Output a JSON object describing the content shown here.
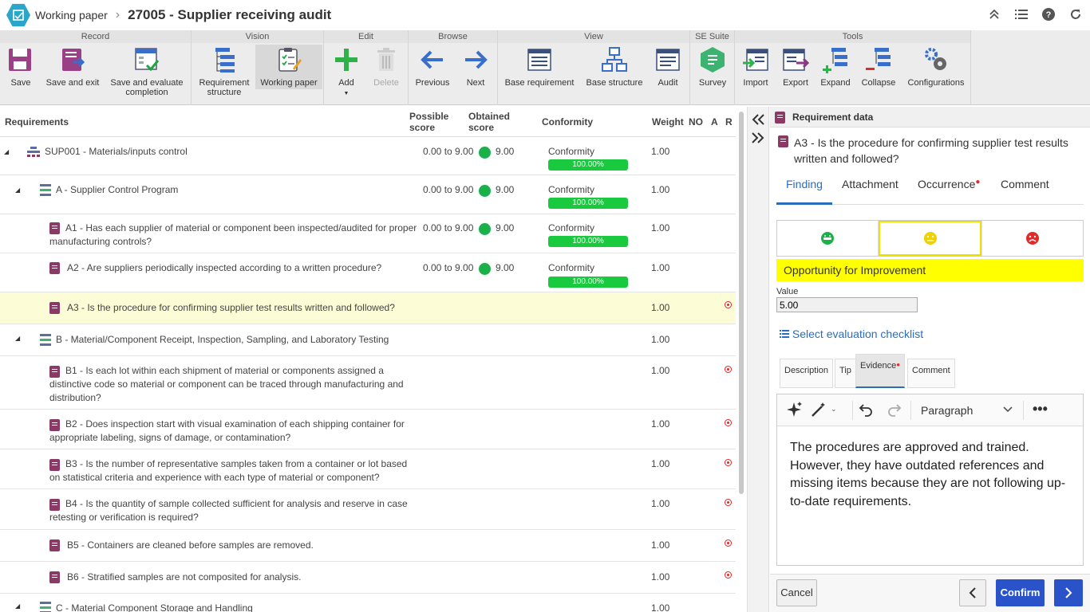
{
  "header": {
    "crumb_parent": "Working paper",
    "separator": "›",
    "title": "27005 - Supplier receiving audit",
    "icons": [
      "collapse-up-icon",
      "list-icon",
      "help-icon",
      "refresh-icon"
    ]
  },
  "ribbon": {
    "groups": {
      "record": "Record",
      "vision": "Vision",
      "edit": "Edit",
      "browse": "Browse",
      "view": "View",
      "suite": "SE Suite",
      "tools": "Tools"
    },
    "buttons": {
      "save": "Save",
      "save_exit": "Save and exit",
      "save_eval_1": "Save and evaluate",
      "save_eval_2": "completion",
      "req_struct_1": "Requirement",
      "req_struct_2": "structure",
      "working_paper": "Working paper",
      "add": "Add",
      "delete": "Delete",
      "previous": "Previous",
      "next": "Next",
      "base_requirement": "Base requirement",
      "base_structure": "Base structure",
      "audit": "Audit",
      "survey": "Survey",
      "import": "Import",
      "export": "Export",
      "expand": "Expand",
      "collapse": "Collapse",
      "configurations": "Configurations"
    }
  },
  "grid": {
    "headers": {
      "requirements": "Requirements",
      "possible_1": "Possible",
      "possible_2": "score",
      "obtained_1": "Obtained",
      "obtained_2": "score",
      "conformity": "Conformity",
      "weight": "Weight",
      "no": "NO",
      "a": "A",
      "r": "R"
    },
    "rows": [
      {
        "text": "SUP001 - Materials/inputs control",
        "possible": "0.00 to 9.00",
        "obtained": "9.00",
        "conf": "Conformity",
        "pct": "100.00%",
        "weight": "1.00"
      },
      {
        "text": "A - Supplier Control Program",
        "possible": "0.00 to 9.00",
        "obtained": "9.00",
        "conf": "Conformity",
        "pct": "100.00%",
        "weight": "1.00"
      },
      {
        "text": "A1 - Has each supplier of material or component been inspected/audited for proper manufacturing controls?",
        "possible": "0.00 to 9.00",
        "obtained": "9.00",
        "conf": "Conformity",
        "pct": "100.00%",
        "weight": "1.00"
      },
      {
        "text": "A2 - Are suppliers periodically inspected according to a written procedure?",
        "possible": "0.00 to 9.00",
        "obtained": "9.00",
        "conf": "Conformity",
        "pct": "100.00%",
        "weight": "1.00"
      },
      {
        "text": "A3 - Is the procedure for confirming supplier test results written and followed?",
        "weight": "1.00"
      },
      {
        "text": "B - Material/Component Receipt, Inspection, Sampling, and Laboratory Testing",
        "weight": "1.00"
      },
      {
        "text": "B1 - Is each lot within each shipment of material or components assigned a distinctive code so material or component can be traced through manufacturing and distribution?",
        "weight": "1.00"
      },
      {
        "text": "B2 - Does inspection start with visual examination of each shipping container for appropriate labeling, signs of damage, or contamination?",
        "weight": "1.00"
      },
      {
        "text": "B3 - Is the number of representative samples taken from a container or lot based on statistical criteria and experience with each type of material or component?",
        "weight": "1.00"
      },
      {
        "text": "B4 - Is the quantity of sample collected sufficient for analysis and reserve in case retesting or verification is required?",
        "weight": "1.00"
      },
      {
        "text": "B5 - Containers are cleaned before samples are removed.",
        "weight": "1.00"
      },
      {
        "text": "B6 - Stratified samples are not composited for analysis.",
        "weight": "1.00"
      },
      {
        "text": "C - Material Component Storage and Handling",
        "weight": "1.00"
      }
    ]
  },
  "panel": {
    "title": "Requirement data",
    "requirement": "A3 - Is the procedure for confirming supplier test results written and followed?",
    "tabs": [
      "Finding",
      "Attachment",
      "Occurrence",
      "Comment"
    ],
    "finding_label": "Opportunity for Improvement",
    "value_label": "Value",
    "value": "5.00",
    "checklist_link": "Select evaluation checklist",
    "subtabs": [
      "Description",
      "Tip",
      "Evidence",
      "Comment"
    ],
    "editor_format": "Paragraph",
    "editor_text": "The procedures are approved and trained. However, they have outdated references and missing items because they are not following up-to-date requirements.",
    "cancel": "Cancel",
    "confirm": "Confirm"
  },
  "colors": {
    "accent": "#2a6ebb",
    "green": "#19c93e",
    "yellow": "#ffff00",
    "red": "#e02b2b",
    "req_icon": "#8a3a64"
  }
}
